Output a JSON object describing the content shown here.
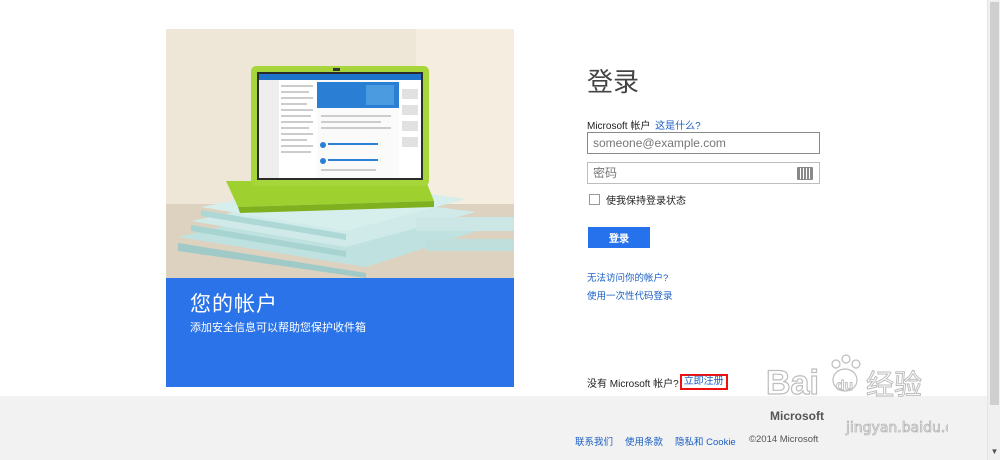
{
  "hero": {
    "title": "您的帐户",
    "subtitle": "添加安全信息可以帮助您保护收件箱",
    "accent_color": "#2a73e8"
  },
  "signin": {
    "title": "登录",
    "account_label": "Microsoft 帐户",
    "whats_this": "这是什么?",
    "email_placeholder": "someone@example.com",
    "password_placeholder": "密码",
    "keep_signed_in": "使我保持登录状态",
    "button": "登录",
    "cant_access": "无法访问你的帐户?",
    "one_time_code": "使用一次性代码登录",
    "no_account": "没有 Microsoft 帐户?",
    "sign_up": "立即注册",
    "button_color": "#2672ec"
  },
  "footer": {
    "logo": "Microsoft",
    "contact": "联系我们",
    "terms": "使用条款",
    "privacy": "隐私和 Cookie",
    "copyright": "©2014 Microsoft"
  },
  "watermark": {
    "brand": "Bai",
    "brand_du": "du",
    "suffix": "经验",
    "url": "jingyan.baidu.com"
  },
  "scrollbar": {
    "up_icon": "▲",
    "down_icon": "▼"
  }
}
